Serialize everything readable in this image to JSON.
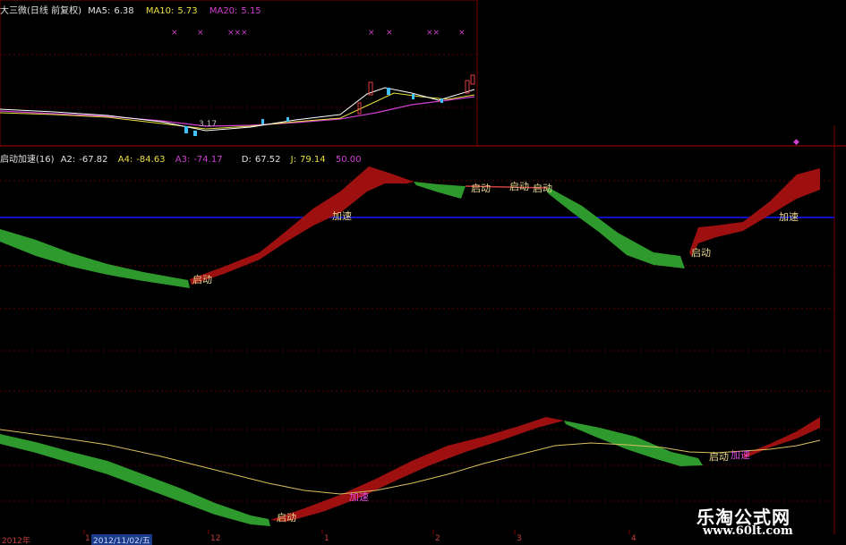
{
  "main_header": {
    "title": "大三微(日线 前复权)",
    "ma5_label": "MA5:",
    "ma5_value": "6.38",
    "ma10_label": "MA10:",
    "ma10_value": "5.73",
    "ma20_label": "MA20:",
    "ma20_value": "5.15"
  },
  "main_chart": {
    "price_marker": "3.17"
  },
  "indicator_header": {
    "name": "启动加速(16)",
    "a2_label": "A2:",
    "a2_value": "-67.82",
    "a4_label": "A4:",
    "a4_value": "-84.63",
    "a3_label": "A3:",
    "a3_value": "-74.17",
    "d_label": "D:",
    "d_value": "67.52",
    "j_label": "J:",
    "j_value": "79.14",
    "level_value": "50.00"
  },
  "signals": {
    "start": "启动",
    "accelerate": "加速"
  },
  "time_axis": {
    "labels": [
      "2012年",
      "1",
      "2012/11/02/五",
      "12",
      "1",
      "2",
      "3",
      "4"
    ]
  },
  "watermark": {
    "title": "乐淘公式网",
    "url": "www.60lt.com"
  },
  "colors": {
    "bull": "#9e1010",
    "bear": "#2e9a2e",
    "ma5": "#ffffff",
    "ma10": "#e8e040",
    "ma20": "#d040d0",
    "gridline": "#7a0000",
    "level_line": "#1010c0",
    "signal_line": "#d8c060"
  }
}
